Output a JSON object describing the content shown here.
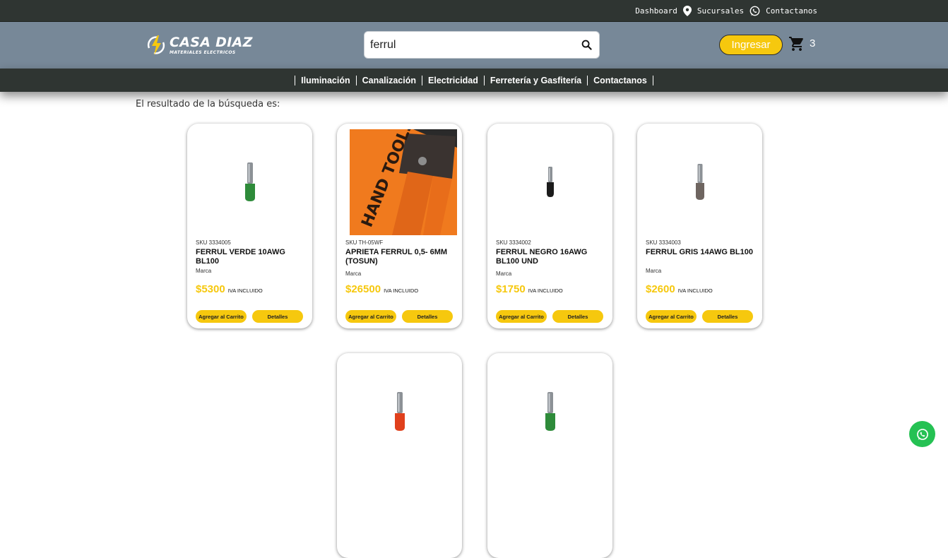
{
  "topbar": {
    "dashboard": "Dashboard",
    "sucursales": "Sucursales",
    "contactanos": "Contactanos"
  },
  "logo": {
    "name": "CASA DIAZ",
    "subtitle": "MATERIALES ELECTRICOS"
  },
  "search": {
    "value": "ferrul"
  },
  "header": {
    "login_label": "Ingresar",
    "cart_count": "3"
  },
  "nav": {
    "items": [
      {
        "label": "Iluminación"
      },
      {
        "label": "Canalización"
      },
      {
        "label": "Electricidad"
      },
      {
        "label": "Ferretería y Gasfitería"
      },
      {
        "label": "Contactanos"
      }
    ]
  },
  "results": {
    "title": "El resultado de la búsqueda es:",
    "products": [
      {
        "sku": "SKU 3334005",
        "name": "FERRUL VERDE 10AWG BL100",
        "brand": "Marca",
        "price": "$5300",
        "iva": "IVA INCLUIDO",
        "add_label": "Agregar al Carrito",
        "details_label": "Detalles",
        "color": "#2e8b3a"
      },
      {
        "sku": "SKU TH-05WF",
        "name": "APRIETA FERRUL 0,5- 6MM (TOSUN)",
        "brand": "Marca",
        "price": "$26500",
        "iva": "IVA INCLUIDO",
        "add_label": "Agregar al Carrito",
        "details_label": "Detalles",
        "color": "#f07a1e"
      },
      {
        "sku": "SKU 3334002",
        "name": "FERRUL NEGRO 16AWG BL100 UND",
        "brand": "Marca",
        "price": "$1750",
        "iva": "IVA INCLUIDO",
        "add_label": "Agregar al Carrito",
        "details_label": "Detalles",
        "color": "#1b1b1b"
      },
      {
        "sku": "SKU 3334003",
        "name": "FERRUL GRIS 14AWG BL100",
        "brand": "Marca",
        "price": "$2600",
        "iva": "IVA INCLUIDO",
        "add_label": "Agregar al Carrito",
        "details_label": "Detalles",
        "color": "#6e6560"
      },
      {
        "color": "#e0401c"
      },
      {
        "color": "#2e8b3a"
      }
    ]
  },
  "colors": {
    "accent": "#f6c80e",
    "header_bg": "#778898",
    "bar_bg": "#2f3532",
    "whatsapp": "#25c153"
  },
  "icons": [
    "location-pin-icon",
    "whatsapp-icon",
    "search-icon",
    "cart-icon",
    "bolt-logo-icon"
  ]
}
